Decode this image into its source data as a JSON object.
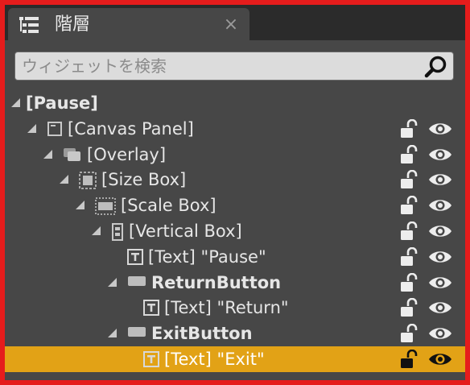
{
  "tab": {
    "title": "階層",
    "close_glyph": "×",
    "icon": "hierarchy-list-icon"
  },
  "search": {
    "placeholder": "ウィジェットを検索",
    "value": "",
    "icon": "search-icon"
  },
  "tree": [
    {
      "label": "[Pause]",
      "bold": true,
      "depth": 0,
      "expander": "expanded",
      "icon": null,
      "controls": false,
      "selected": false
    },
    {
      "label": "[Canvas Panel]",
      "bold": false,
      "depth": 1,
      "expander": "expanded",
      "icon": "canvas-panel-icon",
      "controls": true,
      "selected": false
    },
    {
      "label": "[Overlay]",
      "bold": false,
      "depth": 2,
      "expander": "expanded",
      "icon": "overlay-icon",
      "controls": true,
      "selected": false
    },
    {
      "label": "[Size Box]",
      "bold": false,
      "depth": 3,
      "expander": "expanded",
      "icon": "size-box-icon",
      "controls": true,
      "selected": false
    },
    {
      "label": "[Scale Box]",
      "bold": false,
      "depth": 4,
      "expander": "expanded",
      "icon": "scale-box-icon",
      "controls": true,
      "selected": false
    },
    {
      "label": "[Vertical Box]",
      "bold": false,
      "depth": 5,
      "expander": "expanded",
      "icon": "vertical-box-icon",
      "controls": true,
      "selected": false
    },
    {
      "label": "[Text] \"Pause\"",
      "bold": false,
      "depth": 6,
      "expander": "none",
      "icon": "text-icon",
      "controls": true,
      "selected": false
    },
    {
      "label": "ReturnButton",
      "bold": true,
      "depth": 6,
      "expander": "expanded",
      "icon": "button-icon",
      "controls": true,
      "selected": false
    },
    {
      "label": "[Text] \"Return\"",
      "bold": false,
      "depth": 7,
      "expander": "none",
      "icon": "text-icon",
      "controls": true,
      "selected": false
    },
    {
      "label": "ExitButton",
      "bold": true,
      "depth": 6,
      "expander": "expanded",
      "icon": "button-icon",
      "controls": true,
      "selected": false
    },
    {
      "label": "[Text] \"Exit\"",
      "bold": false,
      "depth": 7,
      "expander": "none",
      "icon": "text-icon",
      "controls": true,
      "selected": true
    }
  ],
  "colors": {
    "selection": "#e2a216",
    "panel": "#474747",
    "frame_border": "#e51c1c"
  }
}
